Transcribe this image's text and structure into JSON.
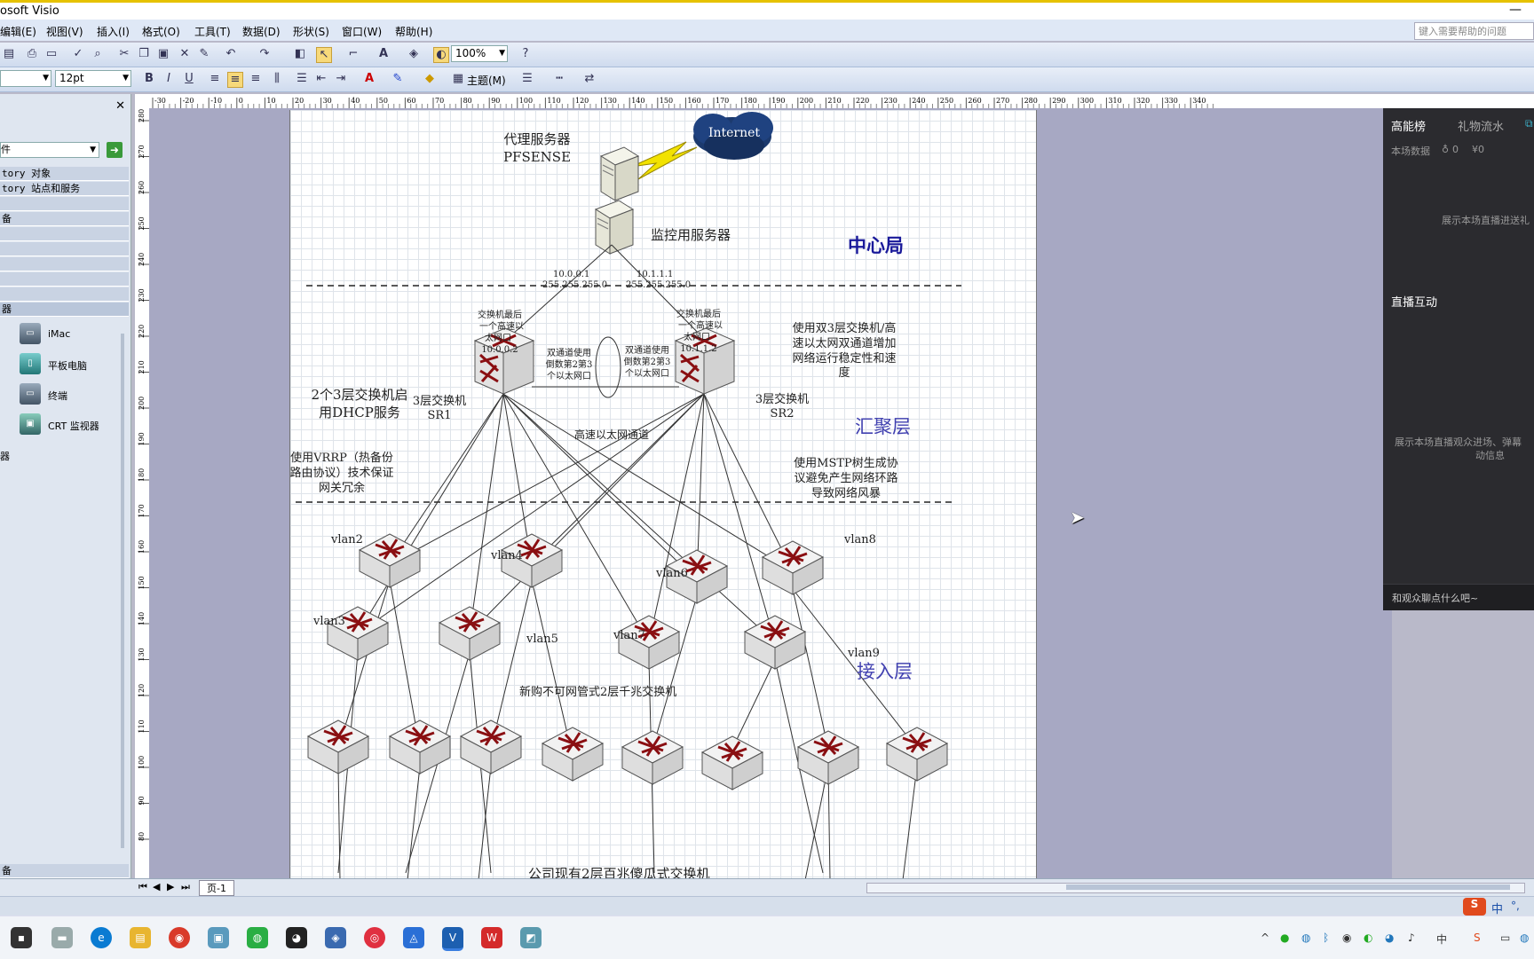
{
  "app": {
    "title": "osoft Visio"
  },
  "menu": [
    "编辑(E)",
    "视图(V)",
    "插入(I)",
    "格式(O)",
    "工具(T)",
    "数据(D)",
    "形状(S)",
    "窗口(W)",
    "帮助(H)"
  ],
  "help_placeholder": "键入需要帮助的问题",
  "toolbar": {
    "zoom": "100%",
    "font_size": "12pt",
    "theme_label": "主题(M)"
  },
  "stencil": {
    "search_label": "件",
    "categories": [
      "tory 对象",
      "tory 站点和服务",
      "",
      "备",
      "",
      "",
      "",
      "",
      "",
      "器"
    ],
    "shapes": [
      {
        "name": "iMac",
        "icon": "imac-icon"
      },
      {
        "name": "平板电脑",
        "icon": "tablet-icon"
      },
      {
        "name": "终端",
        "icon": "terminal-icon"
      },
      {
        "name": "CRT 监视器",
        "icon": "crt-monitor-icon"
      }
    ],
    "side_label_mid": "器",
    "bottom_label": "备"
  },
  "ruler_top": [
    "-30",
    "-20",
    "-10",
    "0",
    "10",
    "20",
    "30",
    "40",
    "50",
    "60",
    "70",
    "80",
    "90",
    "100",
    "110",
    "120",
    "130",
    "140",
    "150",
    "160",
    "170",
    "180",
    "190",
    "200",
    "210",
    "220",
    "230",
    "240",
    "250",
    "260",
    "270",
    "280",
    "290",
    "300",
    "310",
    "320",
    "330",
    "340"
  ],
  "ruler_left": [
    "280",
    "270",
    "260",
    "250",
    "240",
    "230",
    "220",
    "210",
    "200",
    "190",
    "180",
    "170",
    "160",
    "150",
    "140",
    "130",
    "120",
    "110",
    "100",
    "90",
    "80"
  ],
  "diagram": {
    "internet": "Internet",
    "proxy_server": "代理服务器",
    "proxy_name": "PFSENSE",
    "monitor_server": "监控用服务器",
    "zone_core": "中心局",
    "zone_aggregation": "汇聚层",
    "zone_access": "接入层",
    "ip_left": "10.0.0.1",
    "mask_left": "255.255.255.0",
    "ip_right": "10.1.1.1",
    "mask_right": "255.255.255.0",
    "sw_note_left_1": "交换机最后",
    "sw_note_left_2": "一个高速以",
    "sw_note_left_3": "太网口",
    "sw_note_left_4": "10.0.0.2",
    "sw_note_right_1": "交换机最后",
    "sw_note_right_2": "一个高速以",
    "sw_note_right_3": "太网口",
    "sw_note_right_4": "10.1.1.2",
    "dual_note_left_1": "双通道使用",
    "dual_note_left_2": "倒数第2第3",
    "dual_note_left_3": "个以太网口",
    "dual_note_right_1": "双通道使用",
    "dual_note_right_2": "倒数第2第3",
    "dual_note_right_3": "个以太网口",
    "core_note_1": "使用双3层交换机/高",
    "core_note_2": "速以太网双通道增加",
    "core_note_3": "网络运行稳定性和速",
    "core_note_4": "度",
    "dhcp_note_1": "2个3层交换机启",
    "dhcp_note_2": "用DHCP服务",
    "sr1_1": "3层交换机",
    "sr1_2": "SR1",
    "sr2_1": "3层交换机",
    "sr2_2": "SR2",
    "link_label": "高速以太网通道",
    "vrrp_1": "使用VRRP（热备份",
    "vrrp_2": "路由协议）技术保证",
    "vrrp_3": "网关冗余",
    "mstp_1": "使用MSTP树生成协",
    "mstp_2": "议避免产生网络环路",
    "mstp_3": "导致网络风暴",
    "vlans": [
      "vlan2",
      "vlan3",
      "vlan4",
      "vlan5",
      "vlan6",
      "vlan7",
      "vlan8",
      "vlan9"
    ],
    "new_switch_note": "新购不可网管式2层千兆交换机",
    "existing_switch_note": "公司现有2层百兆傻瓜式交换机"
  },
  "page_tab": "页-1",
  "live": {
    "tab_rank": "高能榜",
    "tab_gifts": "礼物流水",
    "stats_label": "本场数据",
    "viewers": "0",
    "income": "¥0",
    "rank_hint": "展示本场直播进送礼",
    "interact_title": "直播互动",
    "interact_hint_1": "展示本场直播观众进场、弹幕",
    "interact_hint_2": "动信息",
    "chat_placeholder": "和观众聊点什么吧~"
  },
  "ime": {
    "lang": "中"
  }
}
